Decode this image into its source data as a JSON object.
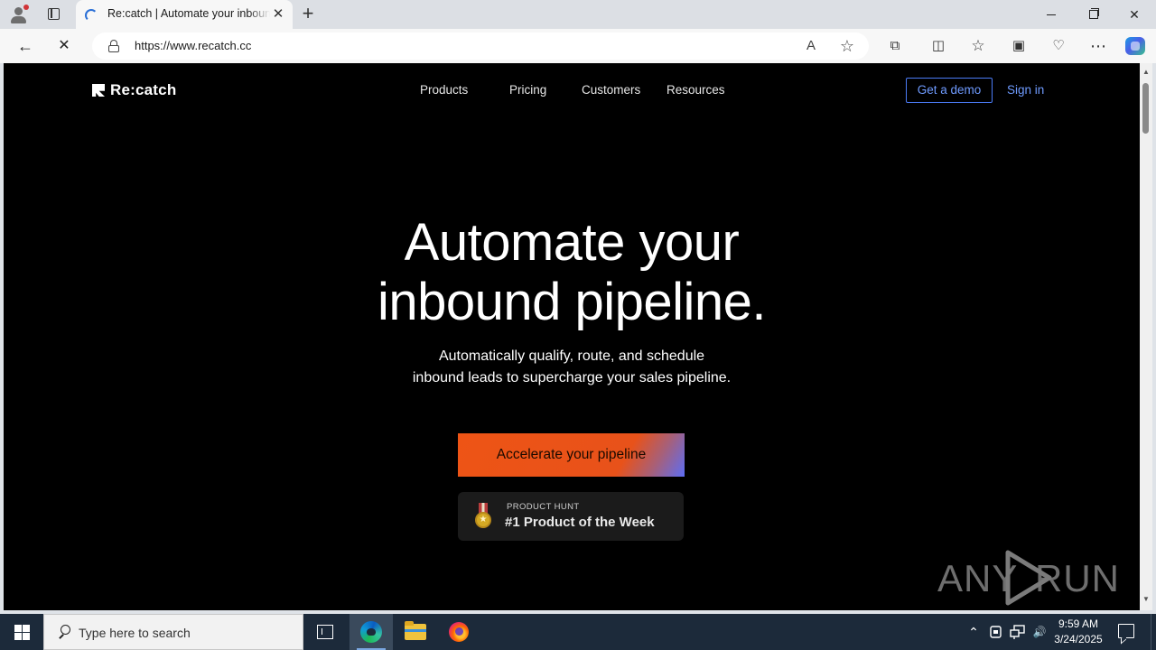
{
  "browser": {
    "tab": {
      "title": "Re:catch | Automate your inbound pipeline",
      "close_glyph": "✕"
    },
    "new_tab_glyph": "+",
    "window_controls": {
      "close_glyph": "✕"
    },
    "nav": {
      "back_glyph": "←",
      "stop_glyph": "✕"
    },
    "address": {
      "url": "https://www.recatch.cc"
    },
    "url_icons": {
      "read_aloud_glyph": "A",
      "favorite_glyph": "☆"
    },
    "toolbar_icons": {
      "extensions_glyph": "⧉",
      "split_glyph": "◫",
      "favorites_glyph": "☆",
      "collections_glyph": "▣",
      "performance_glyph": "♡",
      "more_glyph": "⋯"
    }
  },
  "site": {
    "logo_text": "Re:catch",
    "nav": [
      "Products",
      "Pricing",
      "Customers",
      "Resources"
    ],
    "get_demo": "Get a demo",
    "sign_in": "Sign in",
    "hero": {
      "title_line1": "Automate your",
      "title_line2": "inbound pipeline.",
      "subtitle_line1": "Automatically qualify, route, and schedule",
      "subtitle_line2": "inbound leads to supercharge your sales pipeline."
    },
    "cta_label": "Accelerate your pipeline",
    "product_hunt": {
      "label": "PRODUCT HUNT",
      "title": "#1 Product of the Week",
      "star_glyph": "★"
    },
    "watermark": {
      "left": "ANY",
      "right": "RUN"
    }
  },
  "scrollbar": {
    "up_glyph": "▲",
    "down_glyph": "▼"
  },
  "taskbar": {
    "search_placeholder": "Type here to search",
    "tray": {
      "chevron_glyph": "⌃",
      "volume_glyph": "🔊"
    },
    "clock": {
      "time": "9:59 AM",
      "date": "3/24/2025"
    }
  },
  "colors": {
    "page_background": "#000000",
    "cta_orange": "#ee5415",
    "link_blue": "#6f9bff",
    "taskbar": "#1c2a3a"
  }
}
